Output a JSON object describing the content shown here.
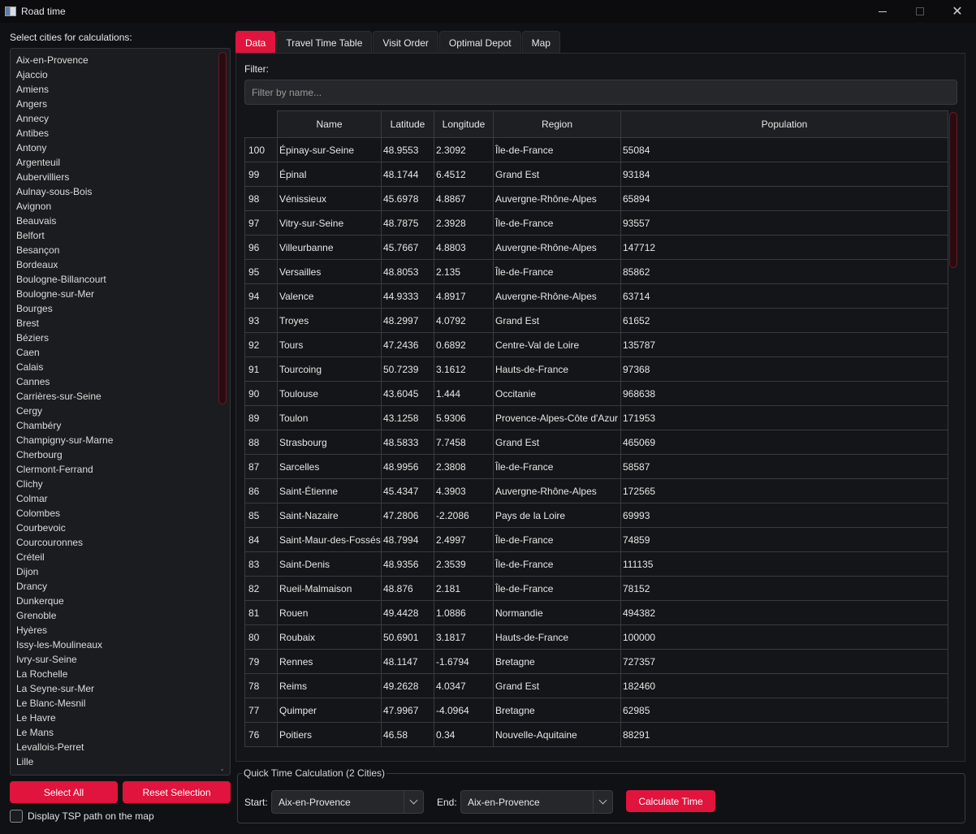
{
  "window": {
    "title": "Road time"
  },
  "left_panel": {
    "label": "Select cities for calculations:",
    "cities": [
      "Aix-en-Provence",
      "Ajaccio",
      "Amiens",
      "Angers",
      "Annecy",
      "Antibes",
      "Antony",
      "Argenteuil",
      "Aubervilliers",
      "Aulnay-sous-Bois",
      "Avignon",
      "Beauvais",
      "Belfort",
      "Besançon",
      "Bordeaux",
      "Boulogne-Billancourt",
      "Boulogne-sur-Mer",
      "Bourges",
      "Brest",
      "Béziers",
      "Caen",
      "Calais",
      "Cannes",
      "Carrières-sur-Seine",
      "Cergy",
      "Chambéry",
      "Champigny-sur-Marne",
      "Cherbourg",
      "Clermont-Ferrand",
      "Clichy",
      "Colmar",
      "Colombes",
      "Courbevoic",
      "Courcouronnes",
      "Créteil",
      "Dijon",
      "Drancy",
      "Dunkerque",
      "Grenoble",
      "Hyères",
      "Issy-les-Moulineaux",
      "Ivry-sur-Seine",
      "La Rochelle",
      "La Seyne-sur-Mer",
      "Le Blanc-Mesnil",
      "Le Havre",
      "Le Mans",
      "Levallois-Perret",
      "Lille"
    ],
    "select_all": "Select All",
    "reset_selection": "Reset Selection",
    "tsp_label": "Display TSP path on the map"
  },
  "tabs": [
    "Data",
    "Travel Time Table",
    "Visit Order",
    "Optimal Depot",
    "Map"
  ],
  "filter": {
    "label": "Filter:",
    "placeholder": "Filter by name..."
  },
  "table": {
    "headers": [
      "Name",
      "Latitude",
      "Longitude",
      "Region",
      "Population"
    ],
    "rows": [
      [
        "100",
        "Épinay-sur-Seine",
        "48.9553",
        "2.3092",
        "Île-de-France",
        "55084"
      ],
      [
        "99",
        "Épinal",
        "48.1744",
        "6.4512",
        "Grand Est",
        "93184"
      ],
      [
        "98",
        "Vénissieux",
        "45.6978",
        "4.8867",
        "Auvergne-Rhône-Alpes",
        "65894"
      ],
      [
        "97",
        "Vitry-sur-Seine",
        "48.7875",
        "2.3928",
        "Île-de-France",
        "93557"
      ],
      [
        "96",
        "Villeurbanne",
        "45.7667",
        "4.8803",
        "Auvergne-Rhône-Alpes",
        "147712"
      ],
      [
        "95",
        "Versailles",
        "48.8053",
        "2.135",
        "Île-de-France",
        "85862"
      ],
      [
        "94",
        "Valence",
        "44.9333",
        "4.8917",
        "Auvergne-Rhône-Alpes",
        "63714"
      ],
      [
        "93",
        "Troyes",
        "48.2997",
        "4.0792",
        "Grand Est",
        "61652"
      ],
      [
        "92",
        "Tours",
        "47.2436",
        "0.6892",
        "Centre-Val de Loire",
        "135787"
      ],
      [
        "91",
        "Tourcoing",
        "50.7239",
        "3.1612",
        "Hauts-de-France",
        "97368"
      ],
      [
        "90",
        "Toulouse",
        "43.6045",
        "1.444",
        "Occitanie",
        "968638"
      ],
      [
        "89",
        "Toulon",
        "43.1258",
        "5.9306",
        "Provence-Alpes-Côte d'Azur",
        "171953"
      ],
      [
        "88",
        "Strasbourg",
        "48.5833",
        "7.7458",
        "Grand Est",
        "465069"
      ],
      [
        "87",
        "Sarcelles",
        "48.9956",
        "2.3808",
        "Île-de-France",
        "58587"
      ],
      [
        "86",
        "Saint-Étienne",
        "45.4347",
        "4.3903",
        "Auvergne-Rhône-Alpes",
        "172565"
      ],
      [
        "85",
        "Saint-Nazaire",
        "47.2806",
        "-2.2086",
        "Pays de la Loire",
        "69993"
      ],
      [
        "84",
        "Saint-Maur-des-Fossés",
        "48.7994",
        "2.4997",
        "Île-de-France",
        "74859"
      ],
      [
        "83",
        "Saint-Denis",
        "48.9356",
        "2.3539",
        "Île-de-France",
        "111135"
      ],
      [
        "82",
        "Rueil-Malmaison",
        "48.876",
        "2.181",
        "Île-de-France",
        "78152"
      ],
      [
        "81",
        "Rouen",
        "49.4428",
        "1.0886",
        "Normandie",
        "494382"
      ],
      [
        "80",
        "Roubaix",
        "50.6901",
        "3.1817",
        "Hauts-de-France",
        "100000"
      ],
      [
        "79",
        "Rennes",
        "48.1147",
        "-1.6794",
        "Bretagne",
        "727357"
      ],
      [
        "78",
        "Reims",
        "49.2628",
        "4.0347",
        "Grand Est",
        "182460"
      ],
      [
        "77",
        "Quimper",
        "47.9967",
        "-4.0964",
        "Bretagne",
        "62985"
      ],
      [
        "76",
        "Poitiers",
        "46.58",
        "0.34",
        "Nouvelle-Aquitaine",
        "88291"
      ]
    ]
  },
  "quick_calc": {
    "title": "Quick Time Calculation (2 Cities)",
    "start_label": "Start:",
    "start_value": "Aix-en-Provence",
    "end_label": "End:",
    "end_value": "Aix-en-Provence",
    "button": "Calculate Time"
  },
  "colors": {
    "accent": "#e0143c",
    "background": "#101114"
  }
}
